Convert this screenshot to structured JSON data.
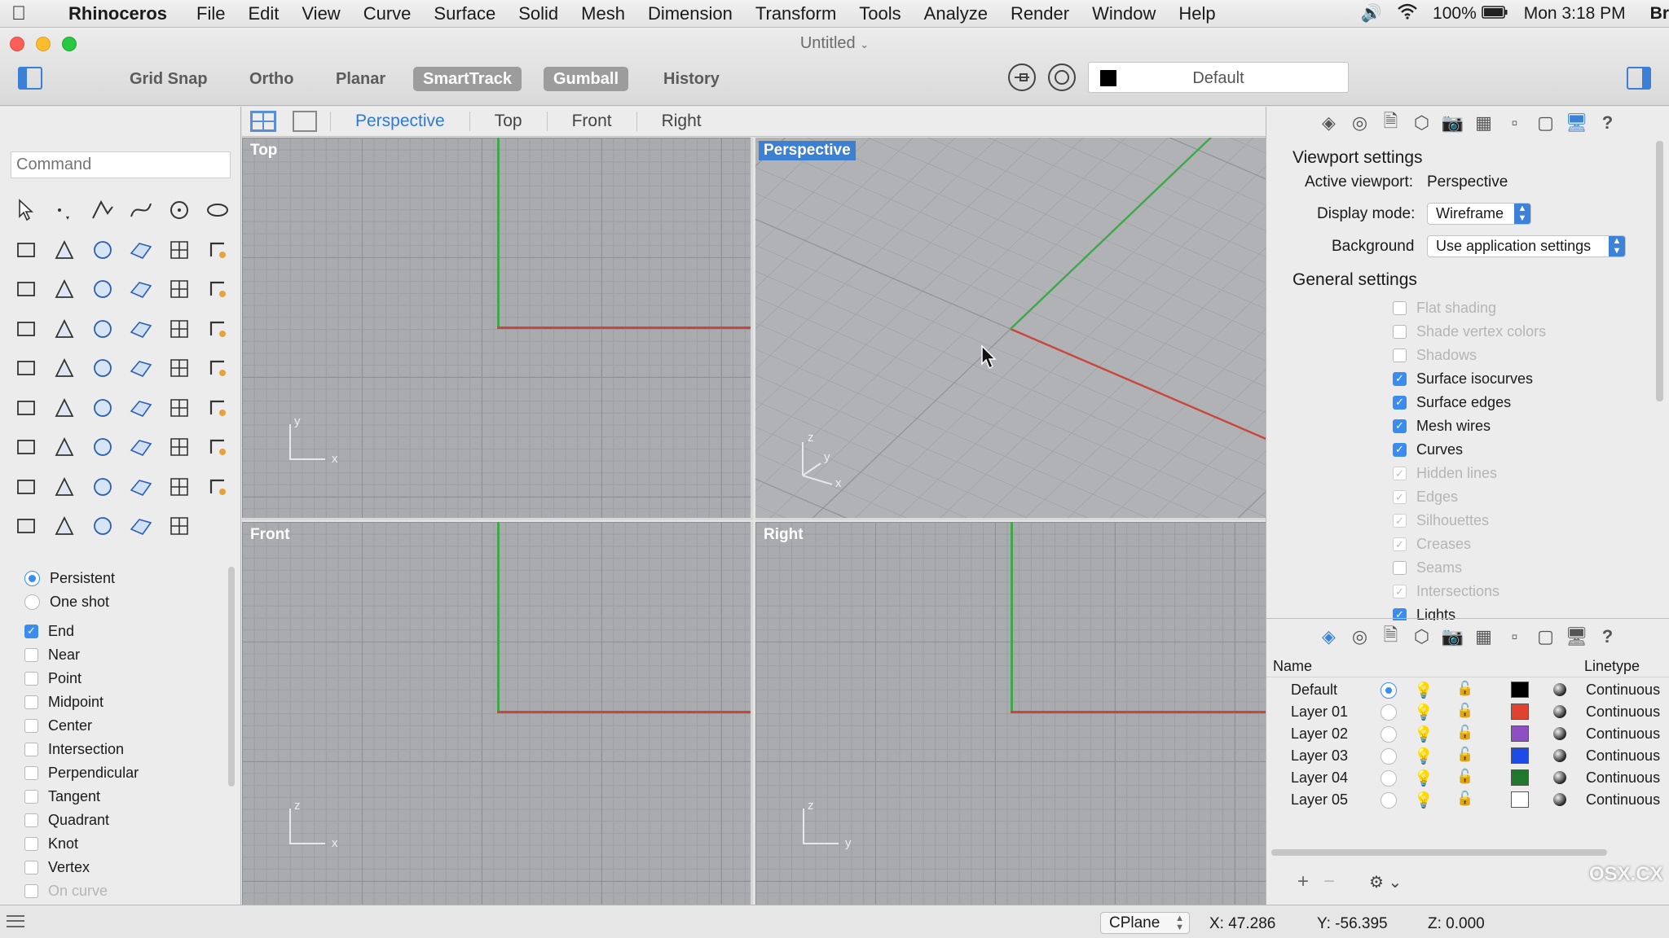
{
  "menubar": {
    "app_name": "Rhinoceros",
    "items": [
      "File",
      "Edit",
      "View",
      "Curve",
      "Surface",
      "Solid",
      "Mesh",
      "Dimension",
      "Transform",
      "Tools",
      "Analyze",
      "Render",
      "Window",
      "Help"
    ],
    "battery": "100%",
    "clock": "Mon 3:18 PM",
    "trailing": "Br"
  },
  "window": {
    "title": "Untitled"
  },
  "toolbar": {
    "grid_snap": "Grid Snap",
    "ortho": "Ortho",
    "planar": "Planar",
    "smarttrack": "SmartTrack",
    "gumball": "Gumball",
    "history": "History",
    "layer_name": "Default",
    "layer_color": "#000000"
  },
  "command": {
    "placeholder": "Command"
  },
  "tools": [
    "select-arrow",
    "point",
    "polyline",
    "curve",
    "circle",
    "ellipse",
    "curve-from-points",
    "rectangle",
    "polygon",
    "fillet-curve",
    "surface-from-curves",
    "surface-patch",
    "box",
    "sphere",
    "cylinder",
    "plane",
    "explode-extrude",
    "blend",
    "extrude",
    "boolean-union",
    "solid-edit",
    "join",
    "sweep",
    "dimension",
    "text",
    "scale",
    "array",
    "orient",
    "mesh-box",
    "dimension-line",
    "grid-array",
    "analyze-direction",
    "surface-edit",
    "check",
    "layout",
    "measure",
    "zoom-in",
    "zoom-extents",
    "zoom-window",
    "zoom-selected",
    "rotate-view",
    "car",
    "planar-grid",
    "snap-points",
    "light",
    "lock",
    "render-material",
    "color-wheel",
    "sphere-globe",
    "mesh-sphere",
    "shaded-sphere",
    "cone",
    "gumball-align"
  ],
  "osnaps": {
    "persistent": "Persistent",
    "one_shot": "One shot",
    "items": [
      {
        "label": "End",
        "checked": true,
        "disabled": false
      },
      {
        "label": "Near",
        "checked": false,
        "disabled": false
      },
      {
        "label": "Point",
        "checked": false,
        "disabled": false
      },
      {
        "label": "Midpoint",
        "checked": false,
        "disabled": false
      },
      {
        "label": "Center",
        "checked": false,
        "disabled": false
      },
      {
        "label": "Intersection",
        "checked": false,
        "disabled": false
      },
      {
        "label": "Perpendicular",
        "checked": false,
        "disabled": false
      },
      {
        "label": "Tangent",
        "checked": false,
        "disabled": false
      },
      {
        "label": "Quadrant",
        "checked": false,
        "disabled": false
      },
      {
        "label": "Knot",
        "checked": false,
        "disabled": false
      },
      {
        "label": "Vertex",
        "checked": false,
        "disabled": false
      },
      {
        "label": "On curve",
        "checked": false,
        "disabled": true
      }
    ]
  },
  "viewport_tabs": [
    "Perspective",
    "Top",
    "Front",
    "Right"
  ],
  "viewports": {
    "top": {
      "label": "Top",
      "axes": [
        "y",
        "x"
      ]
    },
    "perspective": {
      "label": "Perspective",
      "axes": [
        "z",
        "y",
        "x"
      ]
    },
    "front": {
      "label": "Front",
      "axes": [
        "z",
        "x"
      ]
    },
    "right": {
      "label": "Right",
      "axes": [
        "z",
        "y"
      ]
    }
  },
  "viewport_settings": {
    "title": "Viewport settings",
    "active_label": "Active viewport:",
    "active_value": "Perspective",
    "display_mode_label": "Display mode:",
    "display_mode_value": "Wireframe",
    "background_label": "Background",
    "background_value": "Use application settings"
  },
  "general_settings": {
    "title": "General settings",
    "items": [
      {
        "label": "Flat shading",
        "checked": false,
        "disabled": true
      },
      {
        "label": "Shade vertex colors",
        "checked": false,
        "disabled": true
      },
      {
        "label": "Shadows",
        "checked": false,
        "disabled": true
      },
      {
        "label": "Surface isocurves",
        "checked": true,
        "disabled": false
      },
      {
        "label": "Surface edges",
        "checked": true,
        "disabled": false
      },
      {
        "label": "Mesh wires",
        "checked": true,
        "disabled": false
      },
      {
        "label": "Curves",
        "checked": true,
        "disabled": false
      },
      {
        "label": "Hidden lines",
        "checked": true,
        "disabled": true
      },
      {
        "label": "Edges",
        "checked": true,
        "disabled": true
      },
      {
        "label": "Silhouettes",
        "checked": true,
        "disabled": true
      },
      {
        "label": "Creases",
        "checked": true,
        "disabled": true
      },
      {
        "label": "Seams",
        "checked": false,
        "disabled": true
      },
      {
        "label": "Intersections",
        "checked": true,
        "disabled": true
      },
      {
        "label": "Lights",
        "checked": true,
        "disabled": false
      }
    ]
  },
  "layers": {
    "col_name": "Name",
    "col_linetype": "Linetype",
    "rows": [
      {
        "name": "Default",
        "current": true,
        "color": "#000000",
        "linetype": "Continuous"
      },
      {
        "name": "Layer 01",
        "current": false,
        "color": "#e0422f",
        "linetype": "Continuous"
      },
      {
        "name": "Layer 02",
        "current": false,
        "color": "#8e4fc4",
        "linetype": "Continuous"
      },
      {
        "name": "Layer 03",
        "current": false,
        "color": "#1c4be8",
        "linetype": "Continuous"
      },
      {
        "name": "Layer 04",
        "current": false,
        "color": "#22782a",
        "linetype": "Continuous"
      },
      {
        "name": "Layer 05",
        "current": false,
        "color": "#ffffff",
        "linetype": "Continuous"
      }
    ]
  },
  "status": {
    "cplane": "CPlane",
    "x": "X: 47.286",
    "y": "Y: -56.395",
    "z": "Z: 0.000"
  },
  "watermark": "OSX.CX",
  "colors": {
    "accent": "#3b82d8",
    "axis_x": "#c8463a",
    "axis_y": "#3ea84a"
  }
}
